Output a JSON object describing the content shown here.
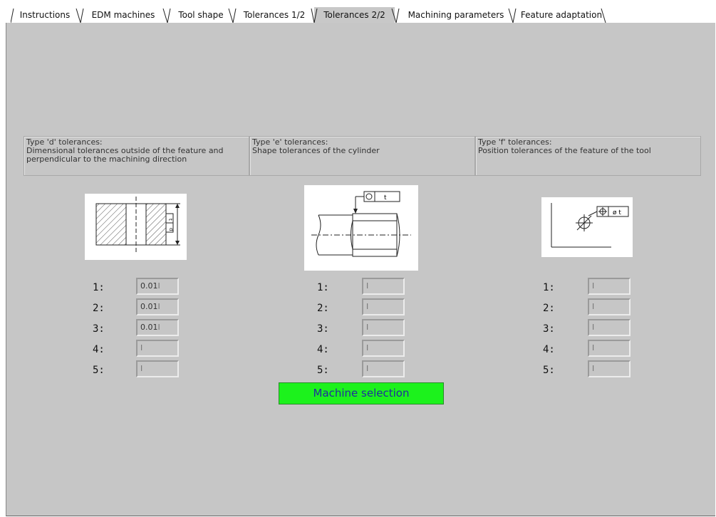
{
  "tabs": [
    {
      "label": "Instructions"
    },
    {
      "label": "EDM machines"
    },
    {
      "label": "Tool shape"
    },
    {
      "label": "Tolerances 1/2"
    },
    {
      "label": "Tolerances 2/2",
      "active": true
    },
    {
      "label": "Machining parameters"
    },
    {
      "label": "Feature adaptation"
    }
  ],
  "sections": [
    {
      "title": "Type 'd' tolerances:",
      "description": "Dimensional tolerances outside of the feature and perpendicular to the machining direction",
      "fields": [
        {
          "label": "1:",
          "value": "0.01"
        },
        {
          "label": "2:",
          "value": "0.01"
        },
        {
          "label": "3:",
          "value": "0.01"
        },
        {
          "label": "4:",
          "value": ""
        },
        {
          "label": "5:",
          "value": ""
        }
      ]
    },
    {
      "title": "Type 'e' tolerances:",
      "description": "Shape tolerances of the cylinder",
      "diagram_label": "t",
      "fields": [
        {
          "label": "1:",
          "value": ""
        },
        {
          "label": "2:",
          "value": ""
        },
        {
          "label": "3:",
          "value": ""
        },
        {
          "label": "4:",
          "value": ""
        },
        {
          "label": "5:",
          "value": ""
        }
      ]
    },
    {
      "title": "Type 'f' tolerances:",
      "description": "Position tolerances of the feature of the tool",
      "diagram_label": "ø t",
      "fields": [
        {
          "label": "1:",
          "value": ""
        },
        {
          "label": "2:",
          "value": ""
        },
        {
          "label": "3:",
          "value": ""
        },
        {
          "label": "4:",
          "value": ""
        },
        {
          "label": "5:",
          "value": ""
        }
      ]
    }
  ],
  "machine_selection_label": "Machine selection",
  "colors": {
    "panel": "#c6c6c6",
    "button": "#1cf21c",
    "button_text": "#1f2f9c"
  }
}
